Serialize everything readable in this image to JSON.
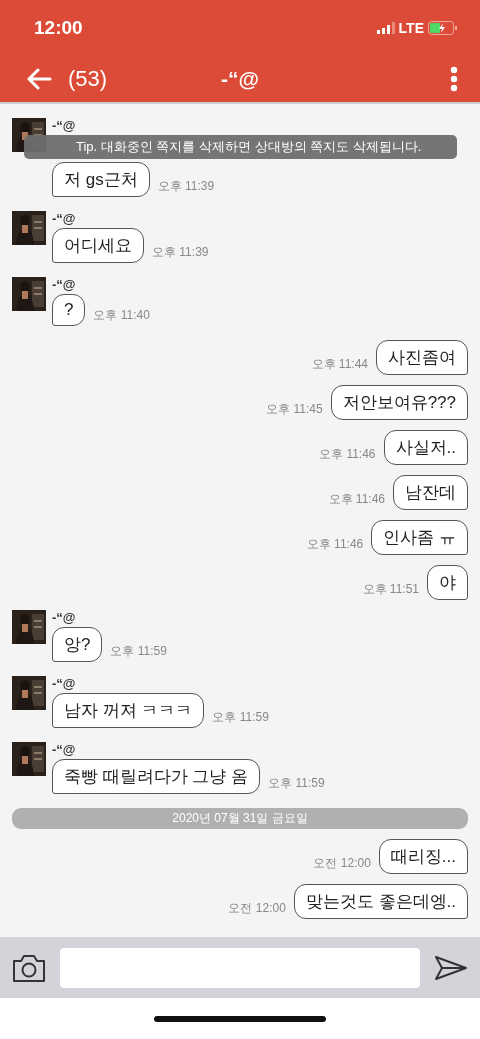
{
  "status_bar": {
    "time": "12:00",
    "network": "LTE"
  },
  "header": {
    "count": "(53)",
    "title": "-“@"
  },
  "tip": "Tip. 대화중인 쪽지를 삭제하면 상대방의 쪽지도 삭제됩니다.",
  "messages": [
    {
      "kind": "incoming",
      "name": "-“@",
      "text": "저 gs근처",
      "time": "오후 11:39"
    },
    {
      "kind": "incoming",
      "name": "-“@",
      "text": "어디세요",
      "time": "오후 11:39"
    },
    {
      "kind": "incoming",
      "name": "-“@",
      "text": "?",
      "time": "오후 11:40"
    },
    {
      "kind": "outgoing",
      "text": "사진좀여",
      "time": "오후 11:44"
    },
    {
      "kind": "outgoing",
      "text": "저안보여유???",
      "time": "오후 11:45"
    },
    {
      "kind": "outgoing",
      "text": "사실저..",
      "time": "오후 11:46"
    },
    {
      "kind": "outgoing",
      "text": "남잔데",
      "time": "오후 11:46"
    },
    {
      "kind": "outgoing",
      "text": "인사좀 ㅠ",
      "time": "오후 11:46"
    },
    {
      "kind": "outgoing",
      "text": "야",
      "time": "오후 11:51"
    },
    {
      "kind": "incoming",
      "name": "-“@",
      "text": "앙?",
      "time": "오후 11:59"
    },
    {
      "kind": "incoming",
      "name": "-“@",
      "text": "남자 꺼져 ㅋㅋㅋ",
      "time": "오후 11:59"
    },
    {
      "kind": "incoming",
      "name": "-“@",
      "text": "죽빵 때릴려다가 그냥 옴",
      "time": "오후 11:59"
    },
    {
      "kind": "date",
      "text": "2020년 07월 31일 금요일"
    },
    {
      "kind": "outgoing",
      "text": "때리징...",
      "time": "오전 12:00"
    },
    {
      "kind": "outgoing",
      "text": "맞는것도 좋은데엥..",
      "time": "오전 12:00"
    }
  ]
}
